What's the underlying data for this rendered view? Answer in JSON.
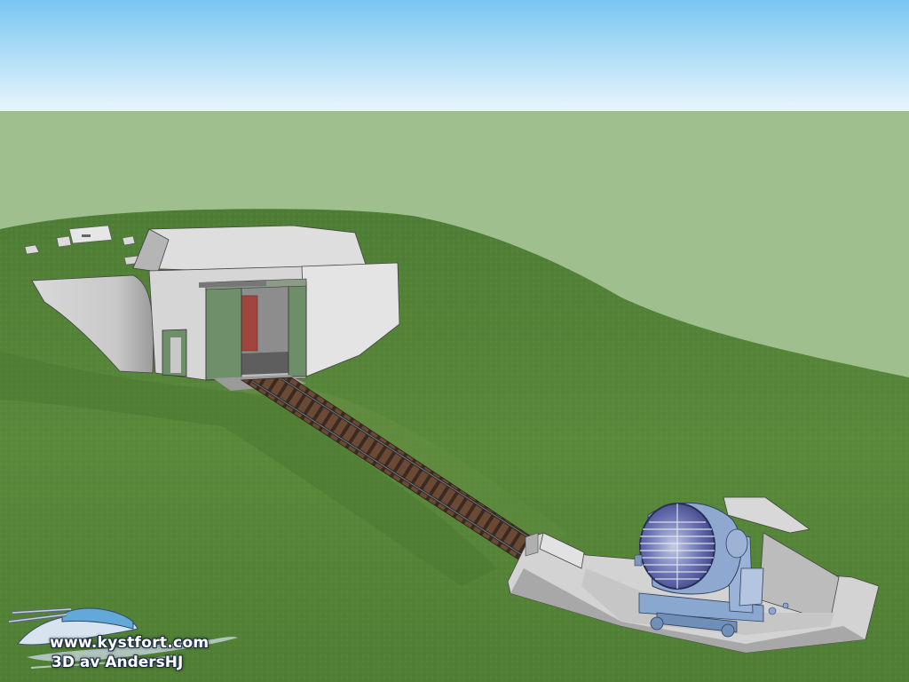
{
  "watermark": {
    "line1": "www.kystfort.com",
    "line2": "3D av AndersHJ"
  },
  "colors": {
    "sky_top": "#7fc9f4",
    "sky_bottom": "#e6f4fb",
    "backdrop": "#9fc08e",
    "grass": "#55843a",
    "concrete": "#dcdcdc",
    "door_green": "#6f8f6a",
    "brick": "#a0463e",
    "rail": "#5e4434",
    "searchlight_blue": "#8aa7d0"
  },
  "icons": [
    "searchlight-icon",
    "cannon-logo-icon"
  ]
}
